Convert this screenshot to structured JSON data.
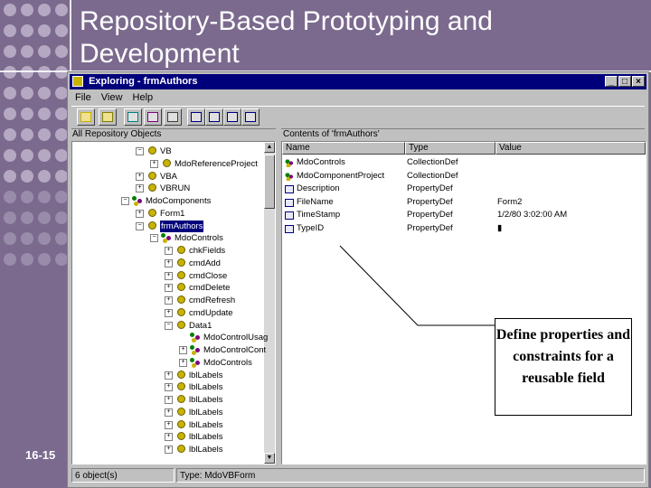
{
  "slide": {
    "title": "Repository-Based Prototyping and Development",
    "page_number": "16-15",
    "callout_text": "Define properties and constraints for a reusable field",
    "accent_color": "#7b6a8e",
    "dot_color": "#b8acc5"
  },
  "window": {
    "title": "Exploring - frmAuthors",
    "controls": [
      "_",
      "□",
      "×"
    ],
    "menu": [
      "File",
      "View",
      "Help"
    ],
    "toolbar_icons": [
      "up-folder-icon",
      "open-icon",
      "browse-icon",
      "move-icon",
      "properties-icon",
      "large-icons-icon",
      "small-icons-icon",
      "list-view-icon",
      "details-view-icon"
    ]
  },
  "tree": {
    "header": "All Repository Objects",
    "nodes": [
      {
        "label": "VB",
        "kind": "ball",
        "exp": "−",
        "depth": 0
      },
      {
        "label": "MdoReferenceProject",
        "kind": "ball",
        "exp": "+",
        "depth": 1
      },
      {
        "label": "VBA",
        "kind": "ball",
        "exp": "+",
        "depth": 0
      },
      {
        "label": "VBRUN",
        "kind": "ball",
        "exp": "+",
        "depth": 0
      },
      {
        "label": "MdoComponents",
        "kind": "cls",
        "exp": "−",
        "depth": -1
      },
      {
        "label": "Form1",
        "kind": "ball",
        "exp": "+",
        "depth": 0
      },
      {
        "label": "frmAuthors",
        "kind": "ball",
        "exp": "−",
        "depth": 0,
        "selected": true
      },
      {
        "label": "MdoControls",
        "kind": "cls",
        "exp": "−",
        "depth": 1
      },
      {
        "label": "chkFields",
        "kind": "ball",
        "exp": "+",
        "depth": 2
      },
      {
        "label": "cmdAdd",
        "kind": "ball",
        "exp": "+",
        "depth": 2
      },
      {
        "label": "cmdClose",
        "kind": "ball",
        "exp": "+",
        "depth": 2
      },
      {
        "label": "cmdDelete",
        "kind": "ball",
        "exp": "+",
        "depth": 2
      },
      {
        "label": "cmdRefresh",
        "kind": "ball",
        "exp": "+",
        "depth": 2
      },
      {
        "label": "cmdUpdate",
        "kind": "ball",
        "exp": "+",
        "depth": 2
      },
      {
        "label": "Data1",
        "kind": "ball",
        "exp": "−",
        "depth": 2
      },
      {
        "label": "MdoControlUsag",
        "kind": "cls",
        "exp": "",
        "depth": 3
      },
      {
        "label": "MdoControlCont",
        "kind": "cls",
        "exp": "+",
        "depth": 3
      },
      {
        "label": "MdoControls",
        "kind": "cls",
        "exp": "+",
        "depth": 3
      },
      {
        "label": "lblLabels",
        "kind": "ball",
        "exp": "+",
        "depth": 2
      },
      {
        "label": "lblLabels",
        "kind": "ball",
        "exp": "+",
        "depth": 2
      },
      {
        "label": "lblLabels",
        "kind": "ball",
        "exp": "+",
        "depth": 2
      },
      {
        "label": "lblLabels",
        "kind": "ball",
        "exp": "+",
        "depth": 2
      },
      {
        "label": "lblLabels",
        "kind": "ball",
        "exp": "+",
        "depth": 2
      },
      {
        "label": "lblLabels",
        "kind": "ball",
        "exp": "+",
        "depth": 2
      },
      {
        "label": "lblLabels",
        "kind": "ball",
        "exp": "+",
        "depth": 2
      }
    ]
  },
  "list": {
    "header": "Contents of 'frmAuthors'",
    "columns": [
      "Name",
      "Type",
      "Value"
    ],
    "rows": [
      {
        "name": "MdoControls",
        "type": "CollectionDef",
        "value": "",
        "icon": "cls"
      },
      {
        "name": "MdoComponentProject",
        "type": "CollectionDef",
        "value": "",
        "icon": "cls"
      },
      {
        "name": "Description",
        "type": "PropertyDef",
        "value": "",
        "icon": "prop"
      },
      {
        "name": "FileName",
        "type": "PropertyDef",
        "value": "Form2",
        "icon": "prop"
      },
      {
        "name": "TimeStamp",
        "type": "PropertyDef",
        "value": "1/2/80 3:02:00 AM",
        "icon": "prop"
      },
      {
        "name": "TypeID",
        "type": "PropertyDef",
        "value": "▮",
        "icon": "prop"
      }
    ]
  },
  "status": {
    "count": "6 object(s)",
    "type": "Type: MdoVBForm"
  }
}
